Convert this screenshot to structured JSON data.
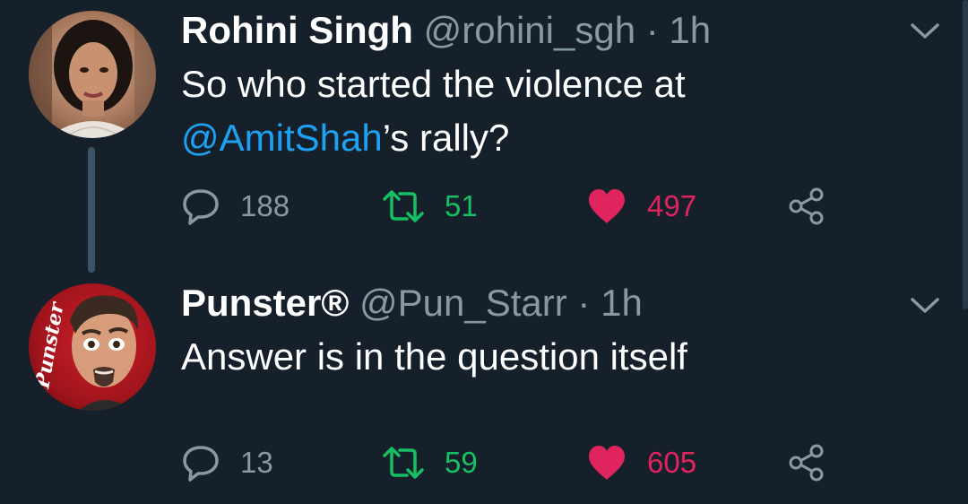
{
  "theme": {
    "background": "#15202b",
    "text": "#ffffff",
    "muted": "#8899a6",
    "link": "#1da1f2",
    "retweet": "#17bf63",
    "like": "#e0245e"
  },
  "tweets": [
    {
      "display_name": "Rohini Singh",
      "handle": "@rohini_sgh",
      "separator": "·",
      "time": "1h",
      "text_parts": {
        "before": "So who started the violence at ",
        "mention": "@AmitShah",
        "after": "’s rally?"
      },
      "reply_count": "188",
      "retweet_count": "51",
      "like_count": "497",
      "liked": true,
      "icons": {
        "reply": "reply-icon",
        "retweet": "retweet-icon",
        "like": "heart-icon",
        "share": "share-icon",
        "menu": "chevron-down-icon"
      }
    },
    {
      "display_name": "Punster®",
      "handle": "@Pun_Starr",
      "separator": "·",
      "time": "1h",
      "avatar_text": "Punster",
      "text": "Answer is in the question itself",
      "reply_count": "13",
      "retweet_count": "59",
      "like_count": "605",
      "liked": true,
      "icons": {
        "reply": "reply-icon",
        "retweet": "retweet-icon",
        "like": "heart-icon",
        "share": "share-icon",
        "menu": "chevron-down-icon"
      }
    }
  ]
}
